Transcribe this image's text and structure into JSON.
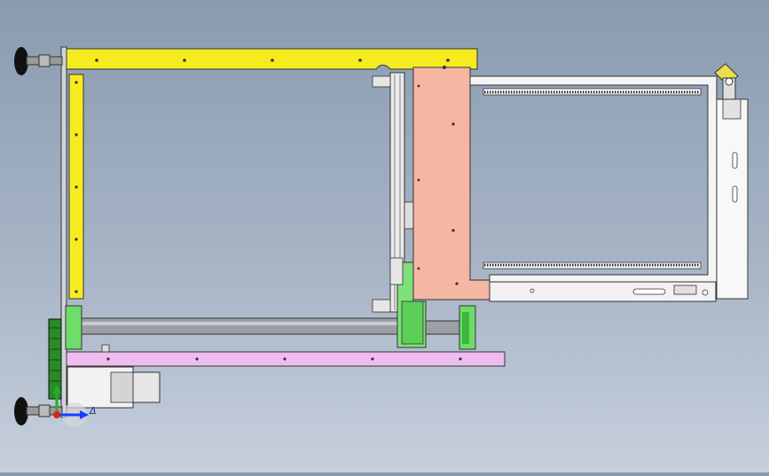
{
  "window": {
    "type": "cad-3d-viewport",
    "view": "front",
    "background_top": "#8a9bb0",
    "background_bottom": "#c6cfdc"
  },
  "colors": {
    "yellow_part": "#f5ec20",
    "salmon_part": "#f5b6a4",
    "pink_part": "#efbcf0",
    "green_part": "#6fdc6a",
    "dark_green_part": "#2a8a2a",
    "grey_part": "#c8c8c8",
    "outline": "#222222",
    "axis_x": "#1a3cff",
    "axis_y": "#22b022",
    "axis_origin": "#e02020"
  },
  "icons": {
    "leveling_feet": "leveling-foot-icon",
    "coordinate_triad": "coordinate-triad-icon"
  },
  "triad": {
    "label": "Δ"
  }
}
